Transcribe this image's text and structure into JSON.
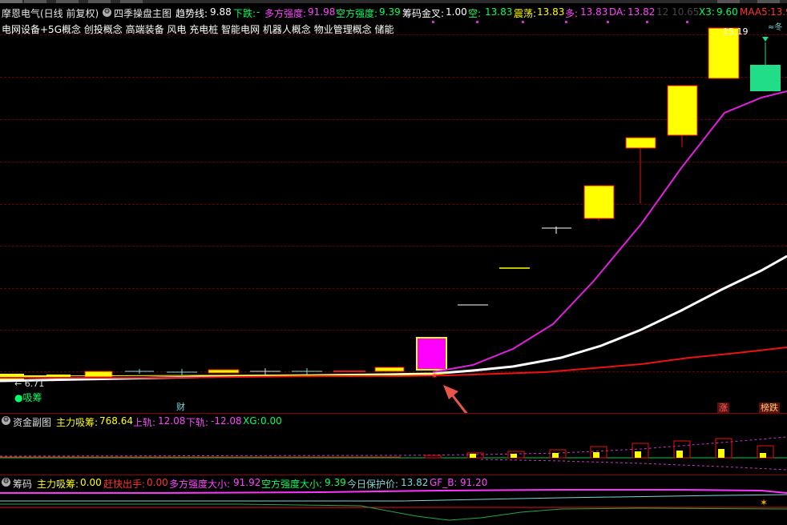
{
  "header": {
    "stock_name": "摩恩电气(日线 前复权)",
    "main_indicator": "四季操盘主图",
    "trend_label": "趋势线:",
    "trend_value": "9.88",
    "down_label": "下跌:",
    "down_value": "-",
    "long_strength_label": "多方强度:",
    "long_strength_value": "91.98",
    "short_strength_label": "空方强度:",
    "short_strength_value": "9.39",
    "chip_cross_label": "筹码金叉:",
    "chip_cross_value": "1.00",
    "empty_label": "空:",
    "empty_value": "13.83",
    "shock_label": "震荡:",
    "shock_value": "13.83",
    "more_label": "多:",
    "more_value": "13.83",
    "da_label": "DA:",
    "da_value": "13.82",
    "faded_values": "12 10.65",
    "x3_label": "X3:",
    "x3_value": "9.60",
    "maa5_label": "MAA5:",
    "maa5_value": "13.9"
  },
  "concepts": "电网设备+5G概念 创投概念 高端装备 风电 充电桩 智能电网 机器人概念 物业管理概念 储能",
  "main_chart": {
    "high_price_label": "15.19",
    "low_price_label": "← 6.71",
    "chip_absorb_label": "●吸筹",
    "finance_tag": "财",
    "rise_tag": "涨",
    "top_list_tag": "榜跌"
  },
  "sub_panel_1": {
    "title": "资金副图",
    "main_absorb_label": "主力吸筹:",
    "main_absorb_value": "768.64",
    "upper_label": "上轨:",
    "upper_value": "12.08",
    "lower_label": "下轨:",
    "lower_value": "-12.08",
    "xg_label": "XG:",
    "xg_value": "0.00"
  },
  "sub_panel_2": {
    "title": "筹码",
    "main_absorb_label": "主力吸筹:",
    "main_absorb_value": "0.00",
    "exit_label": "赶快出手:",
    "exit_value": "0.00",
    "long_strength_label": "多方强度大小:",
    "long_strength_value": "91.92",
    "short_strength_label": "空方强度大小:",
    "short_strength_value": "9.39",
    "protect_label": "今日保护价:",
    "protect_value": "13.82",
    "gfb_label": "GF_B:",
    "gfb_value": "91.20"
  },
  "colors": {
    "rise_candle": "#ffff00",
    "special_candle": "#ff00ff",
    "limit_up_candle": "#22dd88",
    "ma_magenta": "#e020e0",
    "ma_white": "#ffffff",
    "ma_red": "#ee1111",
    "grid": "#6a0000"
  },
  "chart_data": {
    "type": "candlestick",
    "y_axis_visible_range": [
      6.71,
      15.19
    ],
    "candles": [
      {
        "open": 6.9,
        "close": 7.0,
        "high": 7.05,
        "low": 6.71
      },
      {
        "open": 7.0,
        "close": 7.02,
        "high": 7.05,
        "low": 6.95
      },
      {
        "open": 7.0,
        "close": 7.1,
        "high": 7.15,
        "low": 6.95
      },
      {
        "open": 7.05,
        "close": 7.05,
        "high": 7.12,
        "low": 7.0
      },
      {
        "open": 7.08,
        "close": 7.08,
        "high": 7.12,
        "low": 7.02
      },
      {
        "open": 7.05,
        "close": 7.1,
        "high": 7.12,
        "low": 7.0
      },
      {
        "open": 7.08,
        "close": 7.08,
        "high": 7.12,
        "low": 7.02
      },
      {
        "open": 7.05,
        "close": 7.07,
        "high": 7.1,
        "low": 7.02
      },
      {
        "open": 7.05,
        "close": 7.07,
        "high": 7.1,
        "low": 7.02
      },
      {
        "open": 7.1,
        "close": 7.18,
        "high": 7.22,
        "low": 7.05
      },
      {
        "open": 7.2,
        "close": 8.0,
        "high": 8.0,
        "low": 7.2
      },
      {
        "open": 8.7,
        "close": 8.7,
        "high": 8.7,
        "low": 8.7
      },
      {
        "open": 9.5,
        "close": 9.5,
        "high": 9.5,
        "low": 9.5
      },
      {
        "open": 10.45,
        "close": 10.45,
        "high": 10.48,
        "low": 10.35
      },
      {
        "open": 11.0,
        "close": 11.9,
        "high": 11.9,
        "low": 10.98
      },
      {
        "open": 12.85,
        "close": 12.75,
        "high": 12.85,
        "low": 11.85
      },
      {
        "open": 13.4,
        "close": 14.0,
        "high": 14.0,
        "low": 13.1
      },
      {
        "open": 14.3,
        "close": 15.19,
        "high": 15.19,
        "low": 14.3
      },
      {
        "open": 14.0,
        "close": 13.75,
        "high": 14.5,
        "low": 13.75
      }
    ]
  }
}
